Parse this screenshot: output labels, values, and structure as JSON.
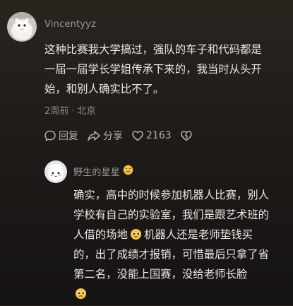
{
  "comment": {
    "username": "Vincentyyz",
    "lines": [
      "这种比赛我大学搞过，强队的车子和代码都是",
      "一届一届学长学姐传承下来的，我当时从头开",
      "始，和别人确实比不了。"
    ],
    "meta": "2周前 · 北京",
    "actions": {
      "reply_label": "回复",
      "share_label": "分享",
      "like_count": "2163"
    }
  },
  "reply": {
    "username": "野生的星星",
    "lines": [
      "确实，高中的时候参加机器人比赛，别人",
      "学校有自己的实验室，我们是跟艺术班的"
    ],
    "line3_a": "人借的场地",
    "line3_b": "机器人还是老师垫钱买",
    "lines_rest": [
      "的，出了成绩才报销，可惜最后只拿了省",
      "第二名，没能上国赛，没给老师长脸"
    ]
  },
  "colors": {
    "background": "#1d1917",
    "text": "#ebe8e4",
    "muted": "#8f8b88",
    "emoji": "#f5c542"
  }
}
